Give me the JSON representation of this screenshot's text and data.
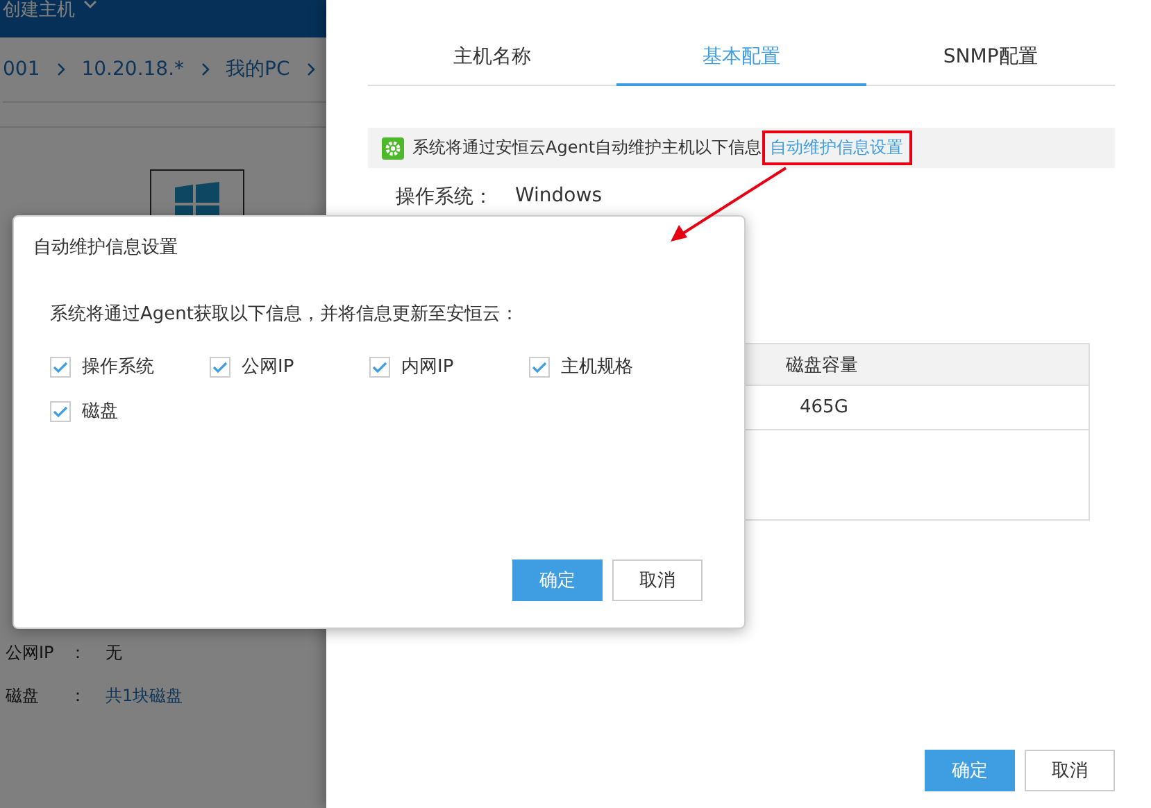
{
  "background_page": {
    "header_title": "创建主机",
    "breadcrumb": [
      "001",
      "10.20.18.*",
      "我的PC"
    ],
    "info_rows": [
      {
        "label": "公网IP",
        "colon": "：",
        "value": "无",
        "kind": "text"
      },
      {
        "label": "磁盘",
        "colon": "：",
        "value": "共1块磁盘",
        "kind": "link"
      }
    ]
  },
  "drawer": {
    "tabs": [
      {
        "label": "主机名称",
        "selected": false
      },
      {
        "label": "基本配置",
        "selected": true
      },
      {
        "label": "SNMP配置",
        "selected": false
      }
    ],
    "notice": {
      "text": "系统将通过安恒云Agent自动维护主机以下信息",
      "link": "自动维护信息设置"
    },
    "os": {
      "label": "操作系统：",
      "value": "Windows"
    },
    "table": {
      "columns": [
        "磁盘容量"
      ],
      "rows": [
        [
          "465G"
        ]
      ]
    },
    "buttons": [
      {
        "label": "确定",
        "kind": "primary"
      },
      {
        "label": "取消",
        "kind": "default"
      }
    ]
  },
  "dialog": {
    "title": "自动维护信息设置",
    "description": "系统将通过Agent获取以下信息，并将信息更新至安恒云：",
    "options": [
      {
        "label": "操作系统",
        "checked": true
      },
      {
        "label": "公网IP",
        "checked": true
      },
      {
        "label": "内网IP",
        "checked": true
      },
      {
        "label": "主机规格",
        "checked": true
      },
      {
        "label": "磁盘",
        "checked": true
      }
    ],
    "buttons": [
      {
        "label": "确定",
        "kind": "primary"
      },
      {
        "label": "取消",
        "kind": "default"
      }
    ]
  }
}
